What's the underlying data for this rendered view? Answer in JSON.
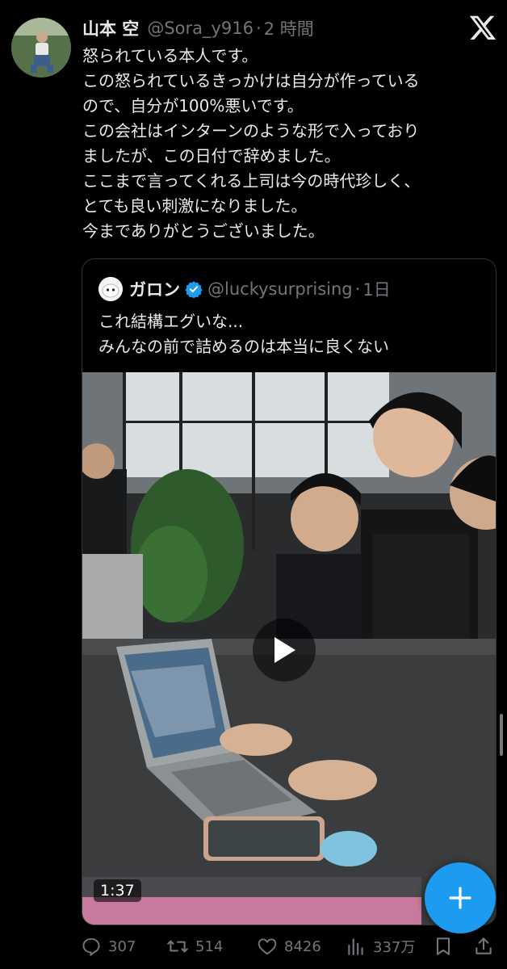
{
  "tweet": {
    "author_name": "山本 空",
    "handle": "@Sora_y916",
    "separator": "·",
    "time": "2 時間",
    "text_lines": [
      "怒られている本人です。",
      "この怒られているきっかけは自分が作っている",
      "ので、自分が100%悪いです。",
      "この会社はインターンのような形で入っており",
      "ましたが、この日付で辞めました。",
      "ここまで言ってくれる上司は今の時代珍しく、",
      "とても良い刺激になりました。",
      "今までありがとうございました。"
    ]
  },
  "quote": {
    "author_name": "ガロン",
    "handle": "@luckysurprising",
    "separator": "·",
    "time": "1日",
    "text_lines": [
      "これ結構エグいな...",
      "みんなの前で詰めるのは本当に良くない"
    ],
    "video": {
      "duration": "1:37"
    }
  },
  "actions": {
    "replies": "307",
    "reposts": "514",
    "likes": "8426",
    "views": "337万"
  },
  "icons": {
    "logo": "x-logo-icon",
    "verified": "verified-badge-icon",
    "play": "play-icon",
    "compose": "plus-icon",
    "reply": "reply-icon",
    "repost": "repost-icon",
    "like": "heart-icon",
    "views": "views-icon",
    "bookmark": "bookmark-icon",
    "share": "share-icon"
  },
  "colors": {
    "background": "#000000",
    "text": "#e7e9ea",
    "secondary_text": "#71767b",
    "accent": "#1d9bf0",
    "card_border": "#2f3336"
  }
}
